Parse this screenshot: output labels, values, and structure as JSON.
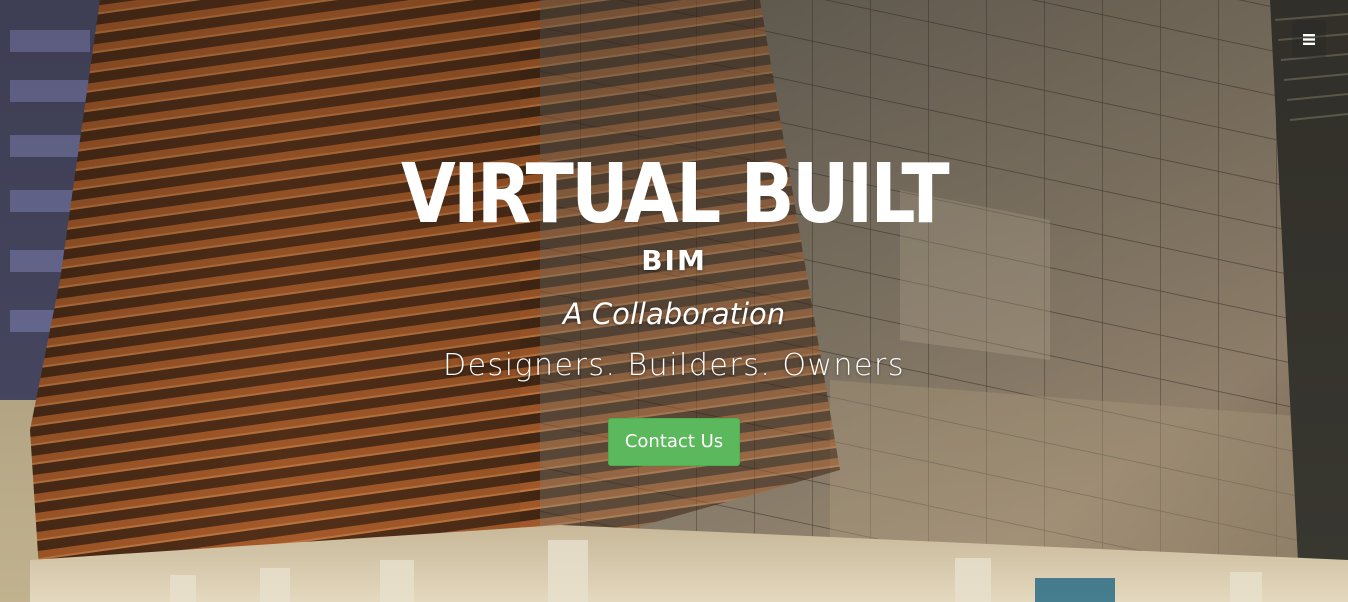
{
  "nav": {
    "menu_icon": "hamburger-menu-icon"
  },
  "hero": {
    "logo_text": "VIRTUAL BUILT",
    "subbrand": "BIM",
    "tagline": "A Collaboration",
    "audience": "Designers. Builders. Owners",
    "cta_label": "Contact Us",
    "background_image": "glass office building facade with copper louvres"
  },
  "colors": {
    "cta_background": "#5cb85c",
    "text": "#ffffff"
  }
}
